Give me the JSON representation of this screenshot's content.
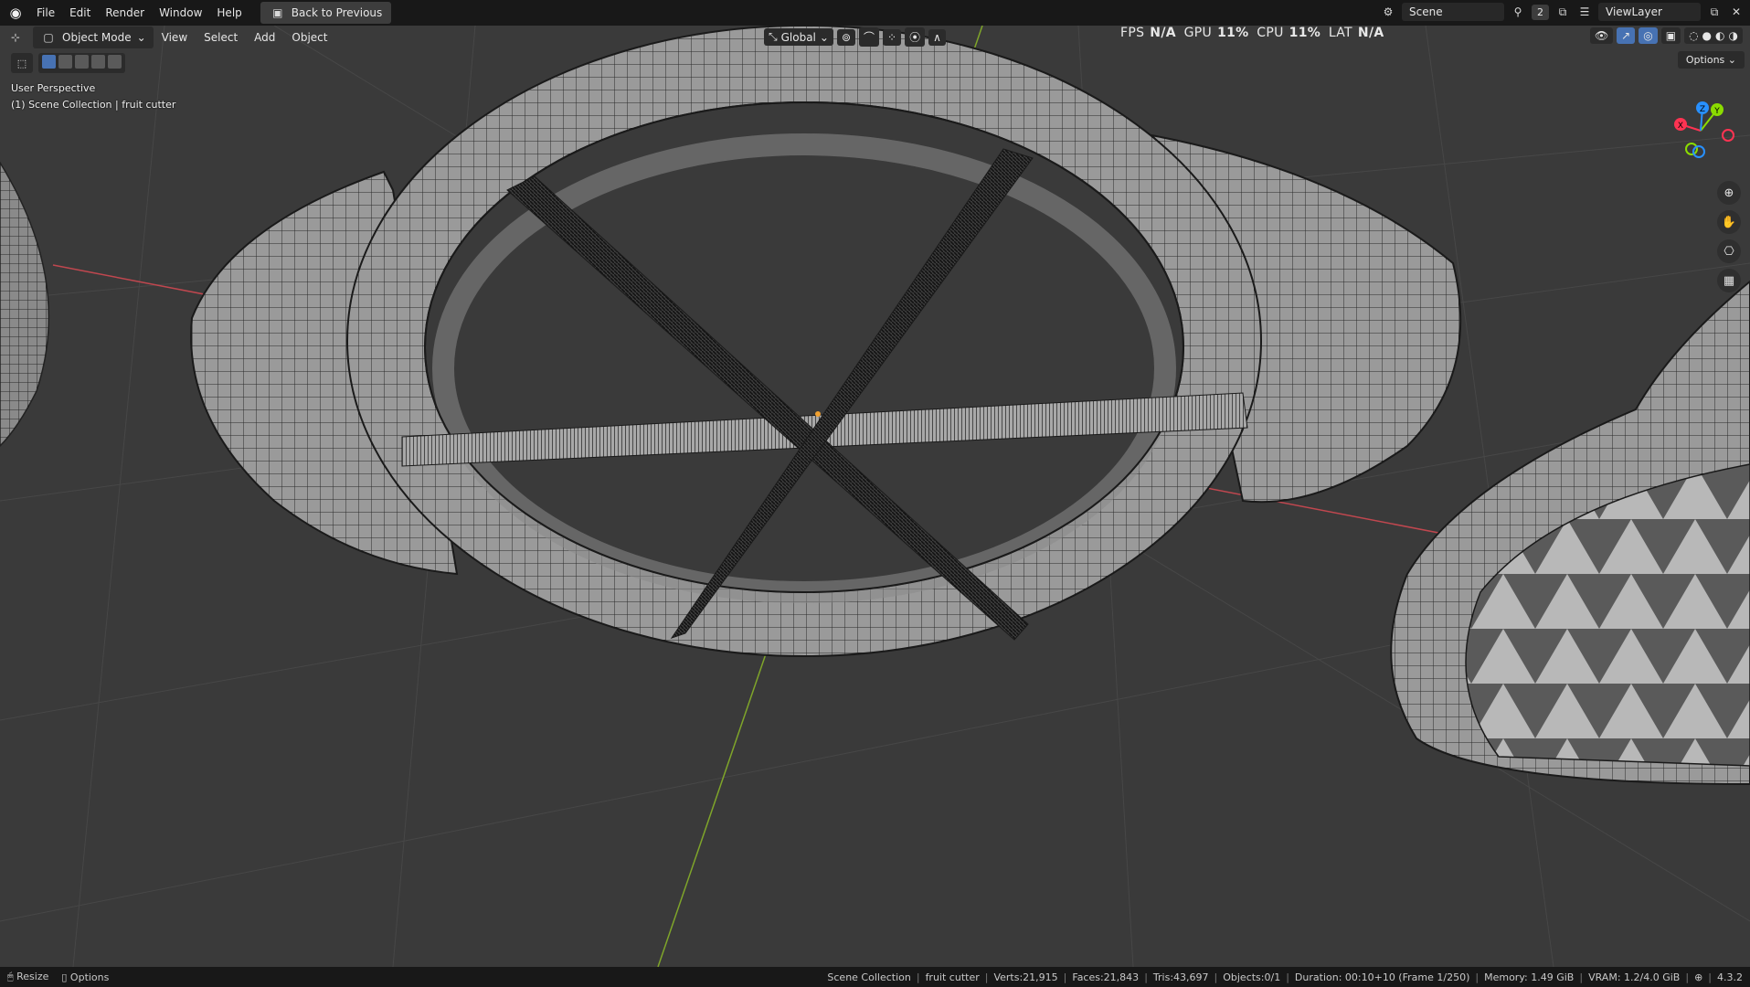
{
  "topbar": {
    "logo_icon": "blender-icon",
    "menus": [
      "File",
      "Edit",
      "Render",
      "Window",
      "Help"
    ],
    "back_button": "Back to Previous",
    "scene_name": "Scene",
    "scene_users": "2",
    "view_layer": "ViewLayer"
  },
  "viewport_header": {
    "mode": "Object Mode",
    "menus": [
      "View",
      "Select",
      "Add",
      "Object"
    ],
    "transform_orientation": "Global",
    "stats": {
      "fps_label": "FPS",
      "fps_value": "N/A",
      "gpu_label": "GPU",
      "gpu_value": "11%",
      "cpu_label": "CPU",
      "cpu_value": "11%",
      "lat_label": "LAT",
      "lat_value": "N/A"
    },
    "options": "Options"
  },
  "viewport_info": {
    "perspective": "User Perspective",
    "collection": "(1) Scene Collection | fruit cutter"
  },
  "gizmo": {
    "x": "X",
    "y": "Y",
    "z": "Z"
  },
  "colors": {
    "x_axis": "#ff3352",
    "y_axis": "#8bdc00",
    "z_axis": "#2890ff",
    "accent": "#4772b3"
  },
  "statusbar": {
    "left": [
      "Resize",
      "Options"
    ],
    "collection": "Scene Collection",
    "object": "fruit cutter",
    "verts": "Verts:21,915",
    "faces": "Faces:21,843",
    "tris": "Tris:43,697",
    "objects": "Objects:0/1",
    "duration": "Duration: 00:10+10 (Frame 1/250)",
    "memory": "Memory: 1.49 GiB",
    "vram": "VRAM: 1.2/4.0 GiB",
    "version": "4.3.2"
  }
}
